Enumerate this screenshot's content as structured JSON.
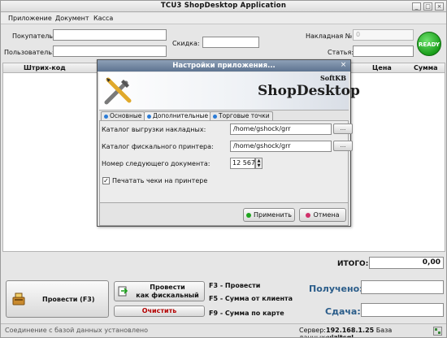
{
  "window": {
    "title": "TCU3 ShopDesktop Application",
    "min": "_",
    "max": "□",
    "close": "×"
  },
  "menu": {
    "items": [
      "Приложение",
      "Документ",
      "Касса"
    ]
  },
  "form": {
    "buyer_label": "Покупатель:",
    "buyer_value": "",
    "discount_label": "Скидка:",
    "discount_value": "",
    "invoice_label": "Накладная №:",
    "invoice_value": "0",
    "user_label": "Пользователь:",
    "user_value": "",
    "article_label": "Статья:",
    "article_value": "",
    "ready_label": "READY"
  },
  "table": {
    "headers": [
      "Штрих-код",
      "Цена",
      "Сумма"
    ]
  },
  "summary": {
    "total_label": "ИТОГО:",
    "total_value": "0,00"
  },
  "actions": {
    "post_label": "Провести (F3)",
    "fiscal_label_1": "Провести",
    "fiscal_label_2": "как фискальный",
    "clear_label": "Очистить",
    "hint_f3": "F3 - Провести",
    "hint_f5": "F5 - Сумма от клиента",
    "hint_f9": "F9 - Сумма по карте",
    "received_label": "Получено:",
    "received_value": "",
    "change_label": "Сдача:",
    "change_value": ""
  },
  "status": {
    "left": "Соединение с базой данных установлено",
    "server_label": "Сервер:",
    "server_value": "192.168.1.25",
    "db_label": "База данных:",
    "db_value": "vizitsql"
  },
  "dialog": {
    "title": "Настройки приложения...",
    "close": "×",
    "brand": "ShopDesktop",
    "brand_small": "SoftKB",
    "tabs": [
      "Основные",
      "Дополнительные",
      "Торговые точки"
    ],
    "active_tab": "Дополнительные",
    "export_label": "Каталог выгрузки накладных:",
    "export_value": "/home/gshock/grr",
    "printer_label": "Каталог фискального принтера:",
    "printer_value": "/home/gshock/grr",
    "nextdoc_label": "Номер следующего документа:",
    "nextdoc_value": "12 567",
    "print_checkbox_label": "Печатать чеки на принтере",
    "print_checked": true,
    "browse": "...",
    "apply_label": "Применить",
    "cancel_label": "Отмена"
  },
  "colors": {
    "ready_green": "#1a9e1a",
    "accent_blue": "#2b5d8a",
    "apply_dot": "#1fa51f",
    "cancel_dot": "#d0306a",
    "tab_dot": "#2a7bd6"
  }
}
